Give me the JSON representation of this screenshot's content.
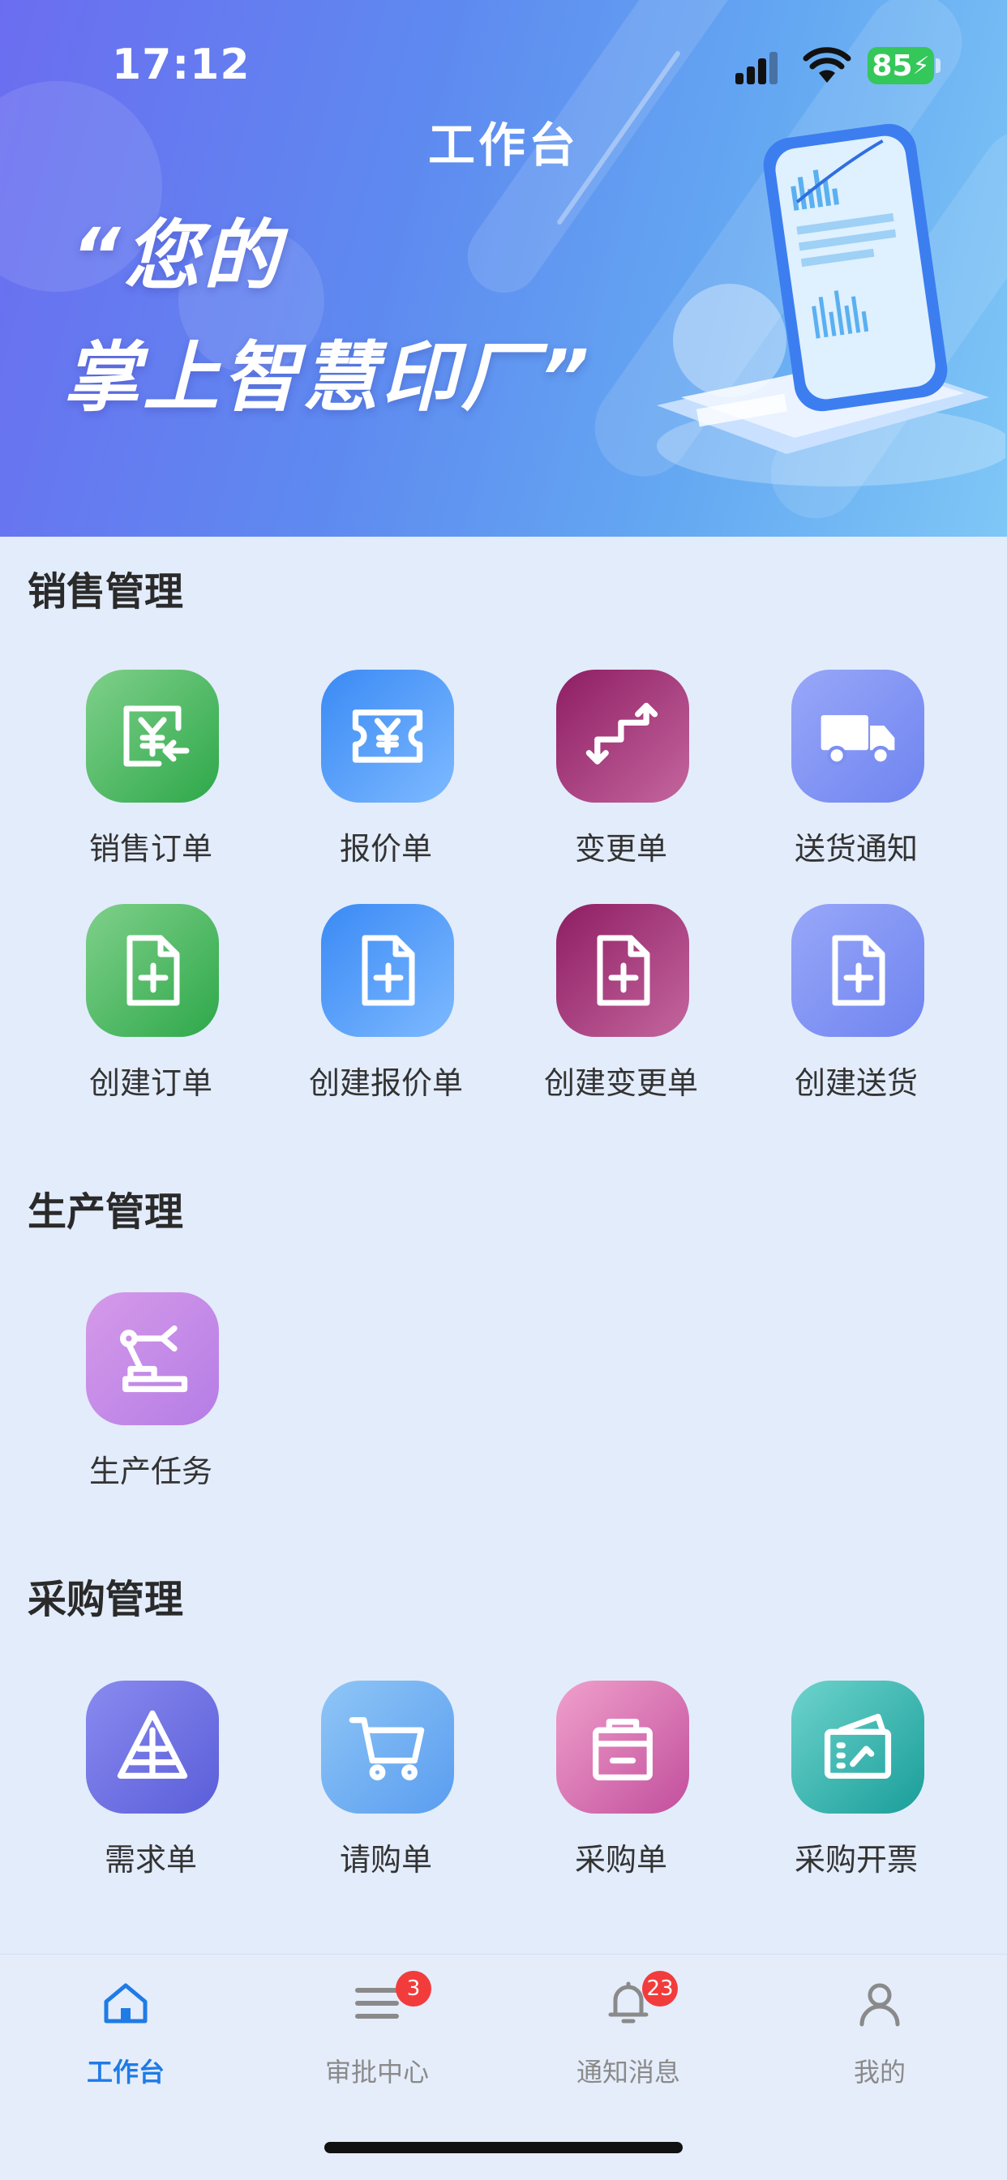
{
  "status_bar": {
    "time": "17:12",
    "battery": "85"
  },
  "banner": {
    "title": "工作台",
    "slogan_line1": "“您的",
    "slogan_line2": "掌上智慧印厂”"
  },
  "sections": [
    {
      "title": "销售管理",
      "items": [
        {
          "label": "销售订单",
          "icon": "yen-receipt-icon"
        },
        {
          "label": "报价单",
          "icon": "yen-ticket-icon"
        },
        {
          "label": "变更单",
          "icon": "exchange-arrows-icon"
        },
        {
          "label": "送货通知",
          "icon": "truck-icon"
        },
        {
          "label": "创建订单",
          "icon": "document-plus-icon"
        },
        {
          "label": "创建报价单",
          "icon": "document-plus-icon"
        },
        {
          "label": "创建变更单",
          "icon": "document-plus-icon"
        },
        {
          "label": "创建送货",
          "icon": "document-plus-icon"
        }
      ]
    },
    {
      "title": "生产管理",
      "items": [
        {
          "label": "生产任务",
          "icon": "robot-arm-icon"
        }
      ]
    },
    {
      "title": "采购管理",
      "items": [
        {
          "label": "需求单",
          "icon": "triangle-tree-icon"
        },
        {
          "label": "请购单",
          "icon": "cart-icon"
        },
        {
          "label": "采购单",
          "icon": "shopping-bag-icon"
        },
        {
          "label": "采购开票",
          "icon": "invoice-card-icon"
        }
      ]
    }
  ],
  "tabbar": [
    {
      "label": "工作台",
      "icon": "home-icon",
      "active": true
    },
    {
      "label": "审批中心",
      "icon": "list-icon",
      "badge": "3"
    },
    {
      "label": "通知消息",
      "icon": "bell-icon",
      "badge": "23"
    },
    {
      "label": "我的",
      "icon": "user-icon"
    }
  ],
  "colors": {
    "accent": "#1f7be6",
    "badge": "#f23c3c",
    "background": "#e3ecfb"
  }
}
